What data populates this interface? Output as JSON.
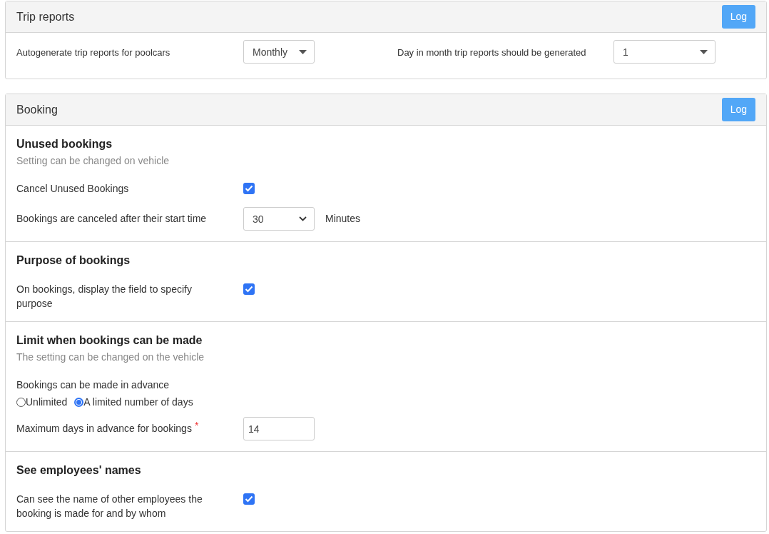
{
  "trip_reports": {
    "title": "Trip reports",
    "log_button": "Log",
    "settings": [
      {
        "kind": "caret_select",
        "label": "Autogenerate trip reports for poolcars",
        "value": "Monthly"
      },
      {
        "kind": "caret_select",
        "label": "Day in month trip reports should be generated",
        "value": "1"
      }
    ]
  },
  "booking": {
    "title": "Booking",
    "log_button": "Log",
    "sections": [
      {
        "heading": "Unused bookings",
        "subheading": "Setting can be changed on vehicle",
        "rows": [
          {
            "kind": "checkbox",
            "label": "Cancel Unused Bookings",
            "checked": true
          },
          {
            "kind": "chevron_select",
            "label": "Bookings are canceled after their start time",
            "value": "30",
            "unit": "Minutes"
          }
        ]
      },
      {
        "heading": "Purpose of bookings",
        "rows": [
          {
            "kind": "checkbox",
            "label": "On bookings, display the field to specify purpose",
            "checked": true
          }
        ]
      },
      {
        "heading": "Limit when bookings can be made",
        "subheading": "The setting can be changed on the vehicle",
        "rows": [
          {
            "kind": "radio",
            "label": "Bookings can be made in advance",
            "options": [
              {
                "label": "Unlimited",
                "selected": false
              },
              {
                "label": "A limited number of days",
                "selected": true
              }
            ]
          },
          {
            "kind": "input",
            "label": "Maximum days in advance for bookings",
            "required_mark": "*",
            "value": "14"
          }
        ]
      },
      {
        "heading": "See employees' names",
        "rows": [
          {
            "kind": "checkbox",
            "label": "Can see the name of other employees the booking is made for and by whom",
            "checked": true
          }
        ]
      }
    ]
  }
}
